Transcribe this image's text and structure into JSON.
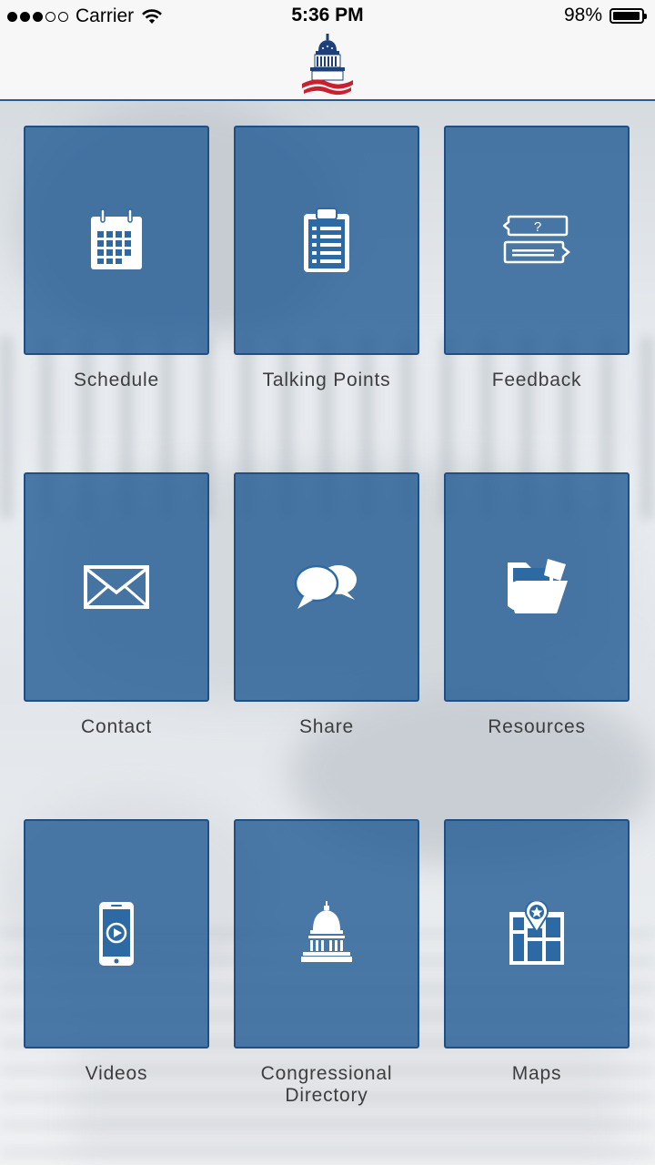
{
  "status_bar": {
    "signal_bars": 5,
    "signal_filled": 3,
    "carrier": "Carrier",
    "time": "5:36 PM",
    "battery_percent": "98%",
    "battery_level": 0.98
  },
  "header": {
    "logo": "capitol-dome-logo"
  },
  "menu": {
    "items": [
      {
        "label": "Schedule",
        "icon": "calendar-icon"
      },
      {
        "label": "Talking Points",
        "icon": "clipboard-icon"
      },
      {
        "label": "Feedback",
        "icon": "feedback-bubbles-icon"
      },
      {
        "label": "Contact",
        "icon": "envelope-icon"
      },
      {
        "label": "Share",
        "icon": "chat-bubbles-icon"
      },
      {
        "label": "Resources",
        "icon": "folder-icon"
      },
      {
        "label": "Videos",
        "icon": "phone-video-icon"
      },
      {
        "label": "Congressional",
        "label_line2": "Directory",
        "icon": "capitol-icon"
      },
      {
        "label": "Maps",
        "icon": "map-pin-icon"
      }
    ]
  },
  "colors": {
    "tile": "#265e96",
    "tile_border": "#1e4f86",
    "label": "#3d3d3d",
    "header_rule": "#2a5a8f",
    "logo_blue": "#1d3f7a",
    "logo_red": "#c8202f"
  }
}
